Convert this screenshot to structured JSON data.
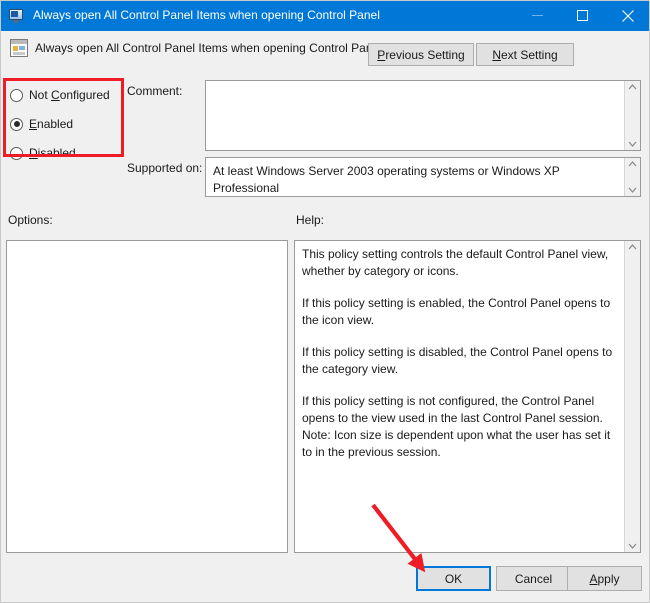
{
  "window": {
    "title": "Always open All Control Panel Items when opening Control Panel",
    "icon": "monitor-policy-icon",
    "controls": {
      "minimize": "minimize-icon",
      "maximize": "maximize-icon",
      "close": "close-icon"
    },
    "accent_color": "#0078d7",
    "background_color": "#f0f0f0"
  },
  "header": {
    "policy_title": "Always open All Control Panel Items when opening Control Panel",
    "policy_icon": "group-policy-setting-icon",
    "previous_setting": {
      "prefix": "P",
      "rest": "revious Setting",
      "full": "Previous Setting"
    },
    "next_setting": {
      "prefix": "N",
      "rest": "ext Setting",
      "full": "Next Setting"
    }
  },
  "state_options": [
    {
      "label_prefix": "Not ",
      "label_accel": "C",
      "label_rest": "onfigured",
      "full": "Not Configured",
      "selected": false
    },
    {
      "label_prefix": "",
      "label_accel": "E",
      "label_rest": "nabled",
      "full": "Enabled",
      "selected": true
    },
    {
      "label_prefix": "",
      "label_accel": "D",
      "label_rest": "isabled",
      "full": "Disabled",
      "selected": false
    }
  ],
  "fields": {
    "comment_label": "Comment:",
    "comment_value": "",
    "supported_label": "Supported on:",
    "supported_value": "At least Windows Server 2003 operating systems or Windows XP Professional",
    "options_label": "Options:",
    "options_value": "",
    "help_label": "Help:"
  },
  "help_paragraphs": [
    "This policy setting controls the default Control Panel view, whether by category or icons.",
    "If this policy setting is enabled, the Control Panel opens to the icon view.",
    "If this policy setting is disabled, the Control Panel opens to the category view.",
    "If this policy setting is not configured, the Control Panel opens to the view used in the last Control Panel session.",
    "Note: Icon size is dependent upon what the user has set it to in the previous session."
  ],
  "buttons": {
    "ok": "OK",
    "cancel": "Cancel",
    "apply_accel": "A",
    "apply_rest": "pply",
    "apply_full": "Apply"
  },
  "annotations": {
    "highlight_color": "#ee1c25",
    "highlight_target": "state-radio-group",
    "arrow_color": "#ee1c25",
    "arrow_target": "ok-button"
  },
  "scrollbars": {
    "up_arrow": "chevron-up-icon",
    "down_arrow": "chevron-down-icon"
  }
}
